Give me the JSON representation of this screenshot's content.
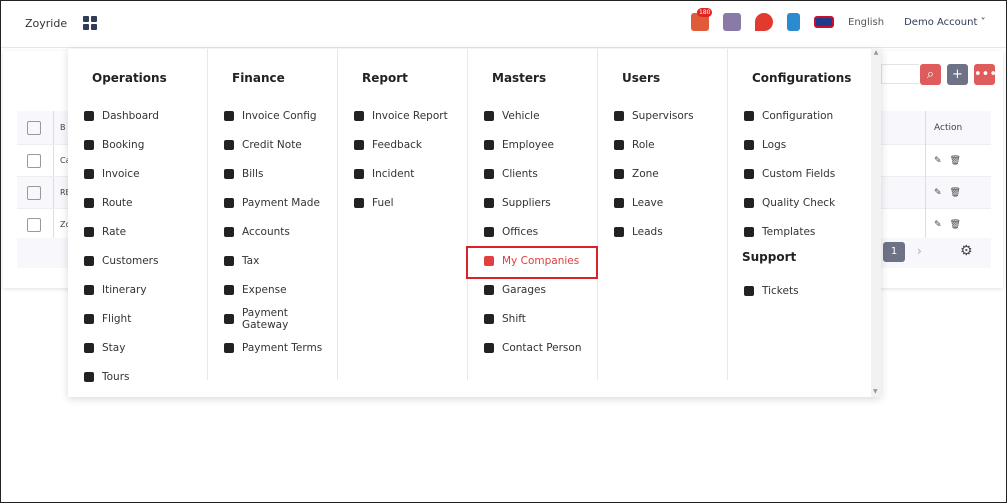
{
  "header": {
    "brand": "Zoyride",
    "notification_count": "180",
    "language": "English",
    "account": "Demo Account",
    "icons": [
      "mail-icon",
      "store-icon",
      "map-pin-icon",
      "book-icon",
      "uk-flag-icon"
    ]
  },
  "table": {
    "header_col": "B",
    "action_header": "Action",
    "rows": [
      "Ca",
      "RB",
      "Zo"
    ],
    "page": "1"
  },
  "colors": {
    "accent": "#e05b5b",
    "secondary": "#6e7287",
    "active_border": "#d9232b"
  },
  "menu": {
    "columns": [
      {
        "title": "Operations",
        "items": [
          "Dashboard",
          "Booking",
          "Invoice",
          "Route",
          "Rate",
          "Customers",
          "Itinerary",
          "Flight",
          "Stay",
          "Tours"
        ]
      },
      {
        "title": "Finance",
        "items": [
          "Invoice Config",
          "Credit Note",
          "Bills",
          "Payment Made",
          "Accounts",
          "Tax",
          "Expense",
          "Payment Gateway",
          "Payment Terms"
        ]
      },
      {
        "title": "Report",
        "items": [
          "Invoice Report",
          "Feedback",
          "Incident",
          "Fuel"
        ]
      },
      {
        "title": "Masters",
        "items": [
          "Vehicle",
          "Employee",
          "Clients",
          "Suppliers",
          "Offices",
          "My Companies",
          "Garages",
          "Shift",
          "Contact Person"
        ],
        "active": "My Companies"
      },
      {
        "title": "Users",
        "items": [
          "Supervisors",
          "Role",
          "Zone",
          "Leave",
          "Leads"
        ]
      },
      {
        "title": "Configurations",
        "items": [
          "Configuration",
          "Logs",
          "Custom Fields",
          "Quality Check",
          "Templates"
        ],
        "subtitle": "Support",
        "subitems": [
          "Tickets"
        ]
      }
    ]
  }
}
